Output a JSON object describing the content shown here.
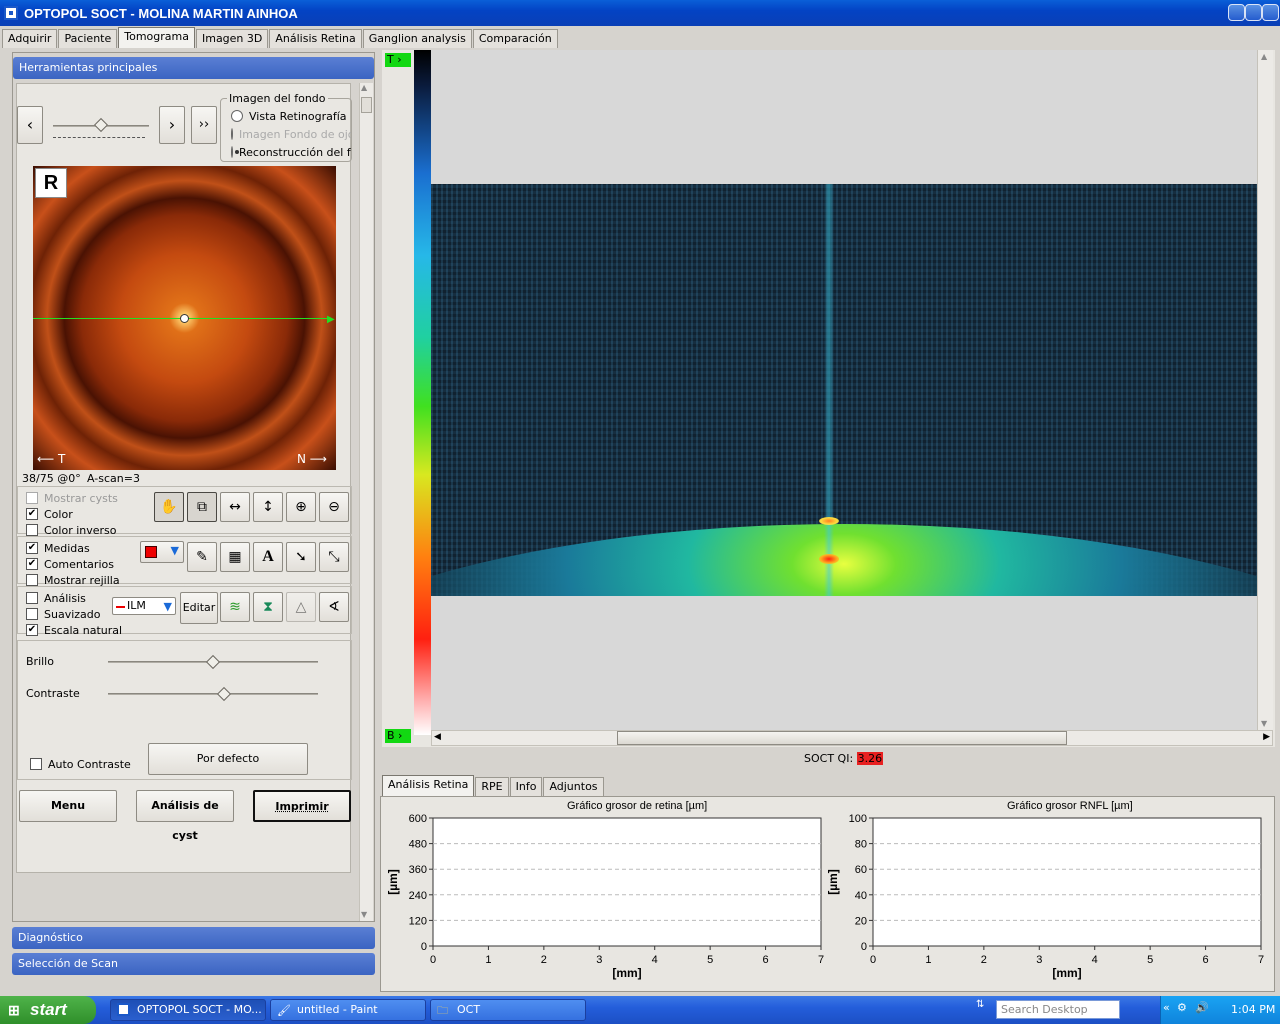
{
  "window": {
    "title": "OPTOPOL SOCT - MOLINA MARTIN AINHOA"
  },
  "tabs": [
    "Adquirir",
    "Paciente",
    "Tomograma",
    "Imagen 3D",
    "Análisis Retina",
    "Ganglion analysis",
    "Comparación"
  ],
  "active_tab": "Tomograma",
  "left": {
    "section_title": "Herramientas principales",
    "nav": {
      "prev": "‹",
      "next": "›",
      "last": "››"
    },
    "fondo": {
      "title": "Imagen del fondo",
      "options": [
        "Vista Retinografía",
        "Imagen Fondo de ojo",
        "Reconstrucción del fondo"
      ],
      "selected": "Reconstrucción del fondo"
    },
    "eye_label": "R",
    "axis_t": "T",
    "axis_n": "N",
    "scan_info": "38/75 @0°",
    "ascan": "A-scan=3",
    "checkboxes": [
      {
        "label": "Mostrar cysts",
        "checked": false,
        "disabled": true
      },
      {
        "label": "Color",
        "checked": true
      },
      {
        "label": "Color inverso",
        "checked": false
      },
      {
        "label": "Medidas",
        "checked": true
      },
      {
        "label": "Comentarios",
        "checked": true
      },
      {
        "label": "Mostrar rejilla",
        "checked": false
      },
      {
        "label": "Análisis",
        "checked": false
      },
      {
        "label": "Suavizado",
        "checked": false
      },
      {
        "label": "Escala natural",
        "checked": true
      }
    ],
    "layer_select": "ILM",
    "editar": "Editar",
    "brillo": "Brillo",
    "brillo_value": 0.5,
    "contraste": "Contraste",
    "contraste_value": 0.55,
    "auto_contraste": "Auto Contraste",
    "por_defecto": "Por defecto",
    "menu": "Menu",
    "analisis_cyst": "Análisis de cyst",
    "imprimir": "Imprimir",
    "diagnostico": "Diagnóstico",
    "seleccion": "Selección de Scan"
  },
  "oct": {
    "top_marker": "T",
    "bottom_marker": "B",
    "qi_label": "SOCT QI:",
    "qi_value": "3.26"
  },
  "bottom_tabs": [
    "Análisis Retina",
    "RPE",
    "Info",
    "Adjuntos"
  ],
  "chart_data": [
    {
      "type": "line",
      "title": "Gráfico grosor de retina [µm]",
      "xlabel": "[mm]",
      "ylabel": "[µm]",
      "xlim": [
        0,
        7
      ],
      "ylim": [
        0,
        600
      ],
      "x_ticks": [
        "0",
        "1",
        "2",
        "3",
        "4",
        "5",
        "6",
        "7"
      ],
      "y_ticks": [
        "0",
        "120",
        "240",
        "360",
        "480",
        "600"
      ],
      "series": []
    },
    {
      "type": "line",
      "title": "Gráfico grosor RNFL  [µm]",
      "xlabel": "[mm]",
      "ylabel": "[µm]",
      "xlim": [
        0,
        7
      ],
      "ylim": [
        0,
        100
      ],
      "x_ticks": [
        "0",
        "1",
        "2",
        "3",
        "4",
        "5",
        "6",
        "7"
      ],
      "y_ticks": [
        "0",
        "20",
        "40",
        "60",
        "80",
        "100"
      ],
      "series": []
    }
  ],
  "taskbar": {
    "start": "start",
    "tasks": [
      "OPTOPOL SOCT - MO...",
      "untitled - Paint",
      "OCT"
    ],
    "search_placeholder": "Search Desktop",
    "clock": "1:04 PM"
  }
}
